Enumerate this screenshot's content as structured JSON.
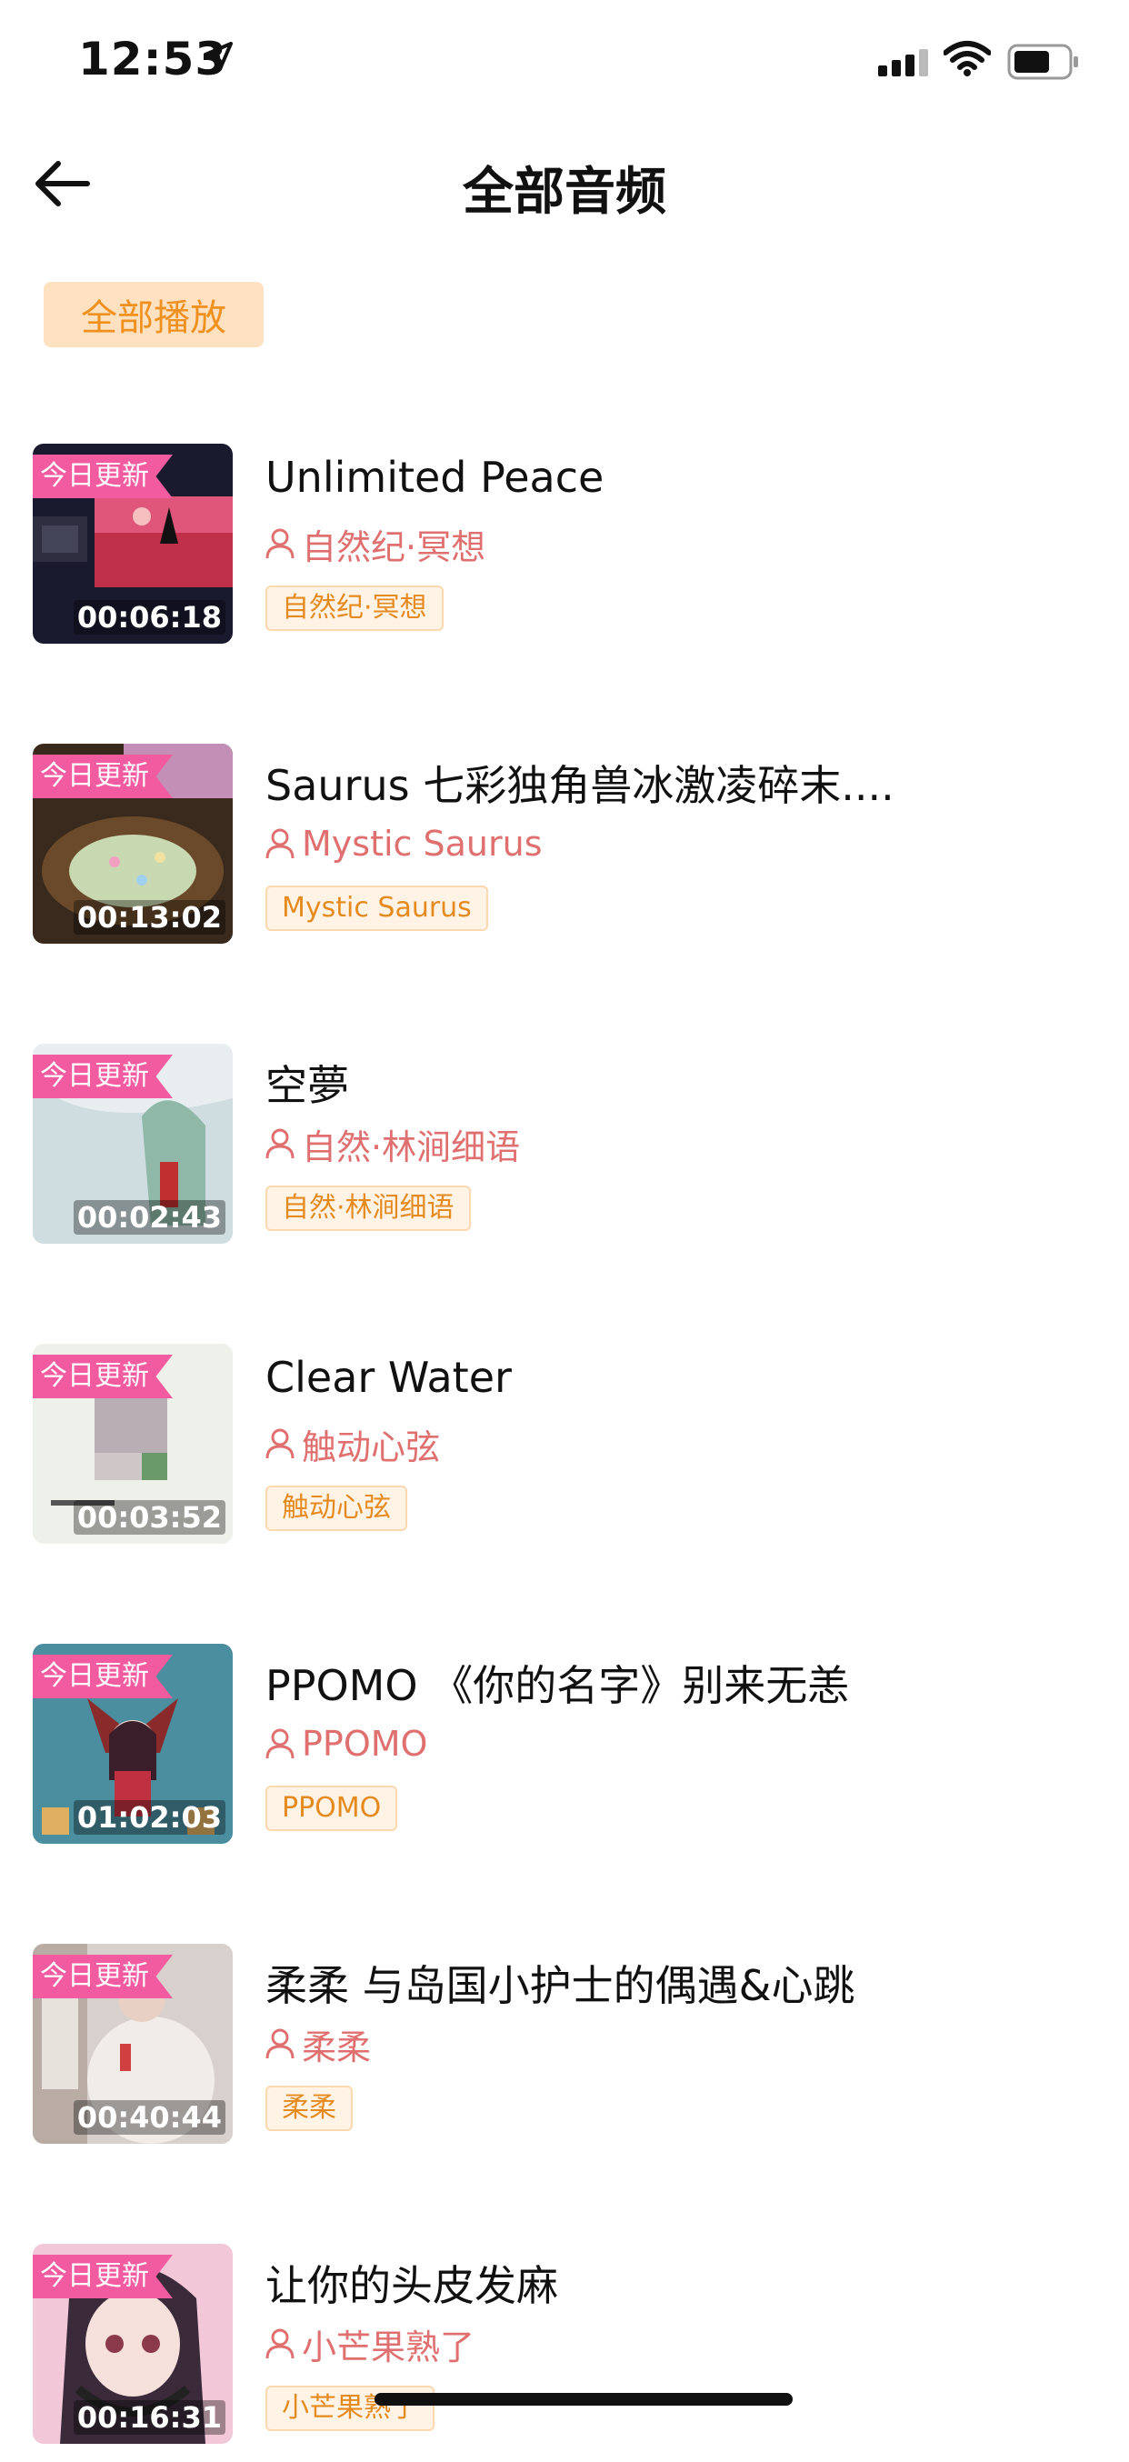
{
  "status_bar": {
    "time": "12:53"
  },
  "nav": {
    "title": "全部音频",
    "back_icon": "arrow-left-icon"
  },
  "play_all_label": "全部播放",
  "colors": {
    "accent": "#f0901e",
    "badge": "#f25b9f",
    "author": "#e07070"
  },
  "items": [
    {
      "title": "Unlimited Peace",
      "author": "自然纪·冥想",
      "tag": "自然纪·冥想",
      "duration": "00:06:18",
      "badge": "今日更新"
    },
    {
      "title": "Saurus 七彩独角兽冰激凌碎末....",
      "author": "Mystic Saurus",
      "tag": "Mystic Saurus",
      "duration": "00:13:02",
      "badge": "今日更新"
    },
    {
      "title": "空夢",
      "author": "自然·林涧细语",
      "tag": "自然·林涧细语",
      "duration": "00:02:43",
      "badge": "今日更新"
    },
    {
      "title": "Clear Water",
      "author": "触动心弦",
      "tag": "触动心弦",
      "duration": "00:03:52",
      "badge": "今日更新"
    },
    {
      "title": "PPOMO 《你的名字》别来无恙",
      "author": "PPOMO",
      "tag": "PPOMO",
      "duration": "01:02:03",
      "badge": "今日更新"
    },
    {
      "title": "柔柔 与岛国小护士的偶遇&心跳",
      "author": "柔柔",
      "tag": "柔柔",
      "duration": "00:40:44",
      "badge": "今日更新"
    },
    {
      "title": "让你的头皮发麻",
      "author": "小芒果熟了",
      "tag": "小芒果熟了",
      "duration": "00:16:31",
      "badge": "今日更新"
    }
  ]
}
